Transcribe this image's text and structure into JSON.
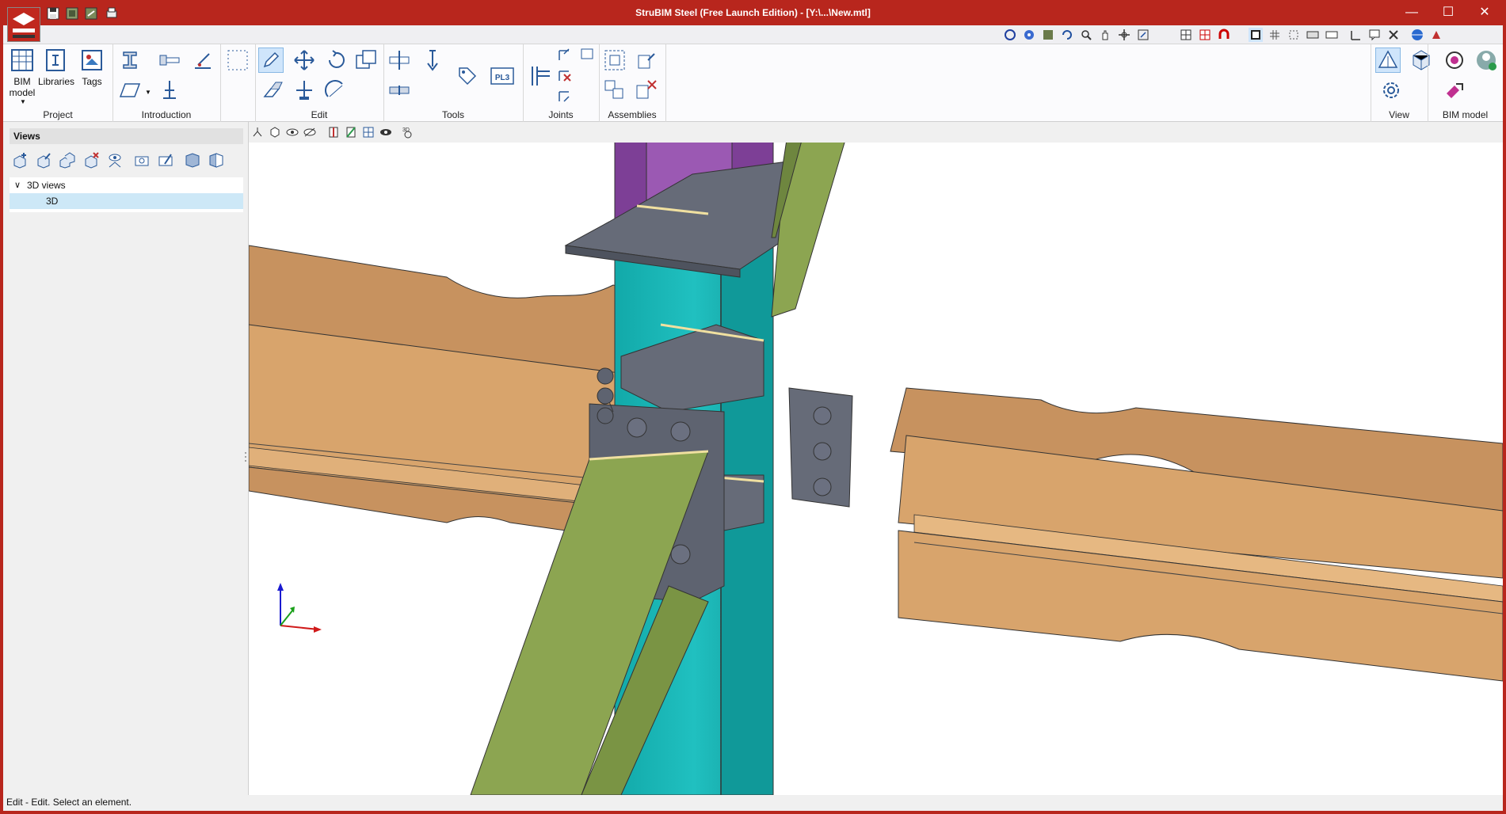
{
  "window": {
    "title": "StruBIM Steel (Free Launch Edition) - [Y:\\...\\New.mtl]",
    "minimize_glyph": "—",
    "maximize_glyph": "☐",
    "close_glyph": "✕"
  },
  "quick_access": [
    "save-icon",
    "save-as-icon",
    "export-icon",
    "print-icon"
  ],
  "view_toolbar_icons": [
    "rotate-icon",
    "orbit-icon",
    "zoom-extents-icon",
    "refresh-icon",
    "zoom-icon",
    "pan-icon",
    "move-view-icon",
    "frame-icon",
    "grid-toggle-icon",
    "error-grid-icon",
    "magnet-icon",
    "window-icon",
    "grid-icon",
    "snap-points-icon",
    "keyboard-icon",
    "scale-icon",
    "angle-icon",
    "comment-icon",
    "tools-icon",
    "globe-icon",
    "appearance-icon"
  ],
  "ribbon": {
    "groups": [
      {
        "label": "Project"
      },
      {
        "label": "Introduction"
      },
      {
        "label": "Edit"
      },
      {
        "label": "Tools"
      },
      {
        "label": "Joints"
      },
      {
        "label": "Assemblies"
      },
      {
        "label": "View"
      },
      {
        "label": "BIM model"
      }
    ],
    "project_buttons": {
      "bim_model_line1": "BIM",
      "bim_model_line2": "model",
      "libraries": "Libraries",
      "tags": "Tags"
    },
    "pl3_label": "PL3"
  },
  "left_panel": {
    "title": "Views",
    "tree": {
      "group_label": "3D views",
      "expand_glyph": "∨",
      "items": [
        {
          "label": "3D"
        }
      ]
    }
  },
  "viewport_toolbar": {
    "icons": [
      "axes-icon",
      "cube-icon",
      "eye-hide-icon",
      "visibility-icon",
      "section-red-icon",
      "section-green-icon",
      "grid-view-icon",
      "eye-icon",
      "view-3d-icon"
    ]
  },
  "status": "Edit - Edit. Select an element.",
  "colors": {
    "title_bar": "#b8261d",
    "beam_orange": "#d8a46c",
    "column_teal": "#1fb3b3",
    "column_purple": "#9b59b3",
    "brace_green": "#8ca551",
    "plate_gray": "#666b78"
  }
}
